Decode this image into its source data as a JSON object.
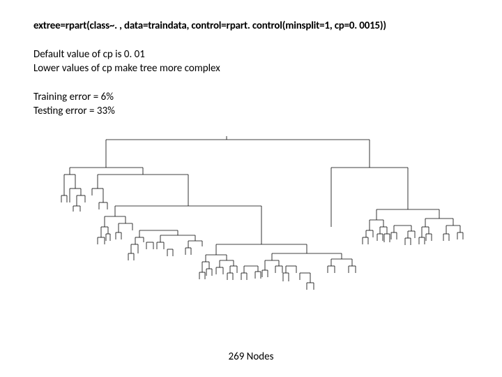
{
  "code": "extree=rpart(class~. , data=traindata, control=rpart. control(minsplit=1, cp=0. 0015))",
  "info": {
    "default_cp": "Default value of cp is 0. 01",
    "lower_cp": "Lower values of cp make tree more complex"
  },
  "errors": {
    "training": "Training error = 6%",
    "testing": "Testing error = 33%"
  },
  "node_count": "269 Nodes",
  "chart_data": {
    "type": "tree",
    "title": "",
    "description": "Dendrogram/decision tree visualization with many terminal nodes",
    "total_nodes": 269,
    "training_error_pct": 6,
    "testing_error_pct": 33,
    "cp_value": 0.0015,
    "minsplit": 1
  }
}
